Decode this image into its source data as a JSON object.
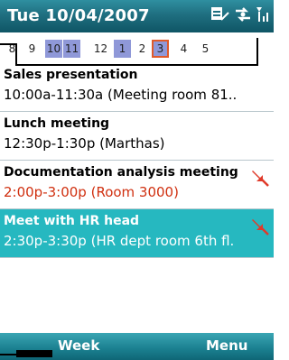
{
  "titlebar": {
    "date": "Tue 10/04/2007",
    "icons": [
      "calendar-sync-icon",
      "network-icon",
      "signal-icon"
    ]
  },
  "hour_strip": {
    "hours": [
      "8",
      "9",
      "10",
      "11",
      "12",
      "1",
      "2",
      "3",
      "4",
      "5"
    ],
    "busy_hours": [
      "10",
      "11",
      "1",
      "3"
    ],
    "current_hour": "3"
  },
  "appointments": [
    {
      "subject": "Sales presentation",
      "detail": "10:00a-11:30a (Meeting room 81..",
      "conflict": false,
      "selected": false
    },
    {
      "subject": "Lunch meeting",
      "detail": "12:30p-1:30p (Marthas)",
      "conflict": false,
      "selected": false
    },
    {
      "subject": "Documentation analysis meeting",
      "detail_time": "2:00p-3:00p",
      "detail_place": " (Room 3000)",
      "conflict": true,
      "selected": false
    },
    {
      "subject": "Meet with HR head",
      "detail": "2:30p-3:30p (HR dept room 6th fl.",
      "conflict": true,
      "selected": true
    }
  ],
  "softkeys": {
    "left": "Week",
    "right": "Menu"
  },
  "colors": {
    "titlebar": "#1f6f80",
    "selected": "#26b8c0",
    "conflict_text": "#d03010",
    "busy": "#8f98d8"
  }
}
